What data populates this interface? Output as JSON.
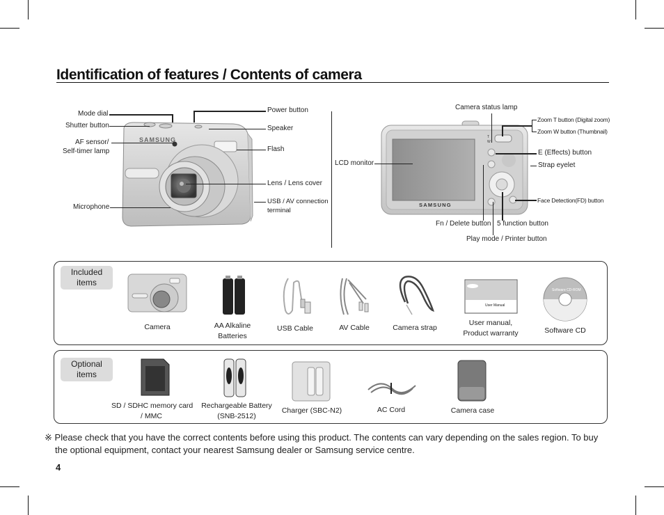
{
  "page": {
    "title": "Identification of features / Contents of camera",
    "page_number": "4"
  },
  "front_view": {
    "labels": {
      "mode_dial": "Mode dial",
      "shutter_button": "Shutter button",
      "af_sensor_line1": "AF sensor/",
      "af_sensor_line2": "Self-timer lamp",
      "microphone": "Microphone",
      "power_button": "Power button",
      "speaker": "Speaker",
      "flash": "Flash",
      "lens": "Lens / Lens cover",
      "usb_av_line1": "USB / AV connection",
      "usb_av_line2": "terminal"
    },
    "brand": "SAMSUNG"
  },
  "back_view": {
    "labels": {
      "camera_status_lamp": "Camera status lamp",
      "zoom_t": "Zoom T button (Digital zoom)",
      "zoom_w": "Zoom W button (Thumbnail)",
      "e_effects": "E (Effects) button",
      "strap_eyelet": "Strap eyelet",
      "lcd_monitor": "LCD monitor",
      "face_detection": "Face Detection(FD) button",
      "fn_delete": "Fn / Delete button",
      "five_function": "5 function button",
      "play_mode": "Play mode / Printer button"
    },
    "brand": "SAMSUNG"
  },
  "included": {
    "tag_line1": "Included",
    "tag_line2": "items",
    "items": [
      {
        "line1": "Camera",
        "line2": ""
      },
      {
        "line1": "AA Alkaline",
        "line2": "Batteries"
      },
      {
        "line1": "USB Cable",
        "line2": ""
      },
      {
        "line1": "AV Cable",
        "line2": ""
      },
      {
        "line1": "Camera strap",
        "line2": ""
      },
      {
        "line1": "User manual,",
        "line2": "Product warranty"
      },
      {
        "line1": "Software CD",
        "line2": ""
      }
    ],
    "manual_cover_text": "User Manual",
    "cd_text": "Software CD-ROM"
  },
  "optional": {
    "tag_line1": "Optional",
    "tag_line2": "items",
    "items": [
      {
        "line1": "SD / SDHC memory card",
        "line2": "/ MMC"
      },
      {
        "line1": "Rechargeable Battery",
        "line2": "(SNB-2512)"
      },
      {
        "line1": "Charger (SBC-N2)",
        "line2": ""
      },
      {
        "line1": "AC Cord",
        "line2": ""
      },
      {
        "line1": "Camera case",
        "line2": ""
      }
    ]
  },
  "note": {
    "symbol": "※",
    "line1": "Please check that you have the correct contents before using this product. The contents can vary depending on the sales region. To buy",
    "line2": "the optional equipment, contact your nearest Samsung dealer or Samsung service centre."
  }
}
